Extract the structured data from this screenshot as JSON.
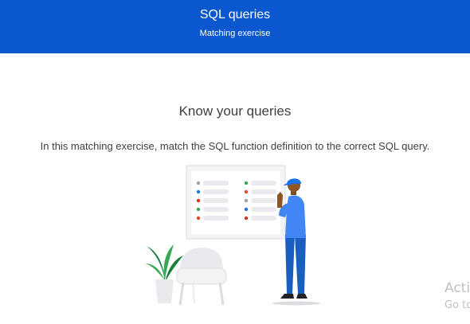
{
  "header": {
    "title": "SQL queries",
    "subtitle": "Matching exercise",
    "background": "#0b57d0"
  },
  "main": {
    "heading": "Know your queries",
    "intro": "In this matching exercise, match the SQL function definition to the correct SQL query."
  },
  "illustration": {
    "icon": "person-at-whiteboard-illustration",
    "dot_colors": [
      "#9aa0a6",
      "#1a73e8",
      "#d93025",
      "#34a853",
      "#ea4335"
    ]
  },
  "watermark": {
    "line1": "Acti",
    "line2": "Go to"
  }
}
